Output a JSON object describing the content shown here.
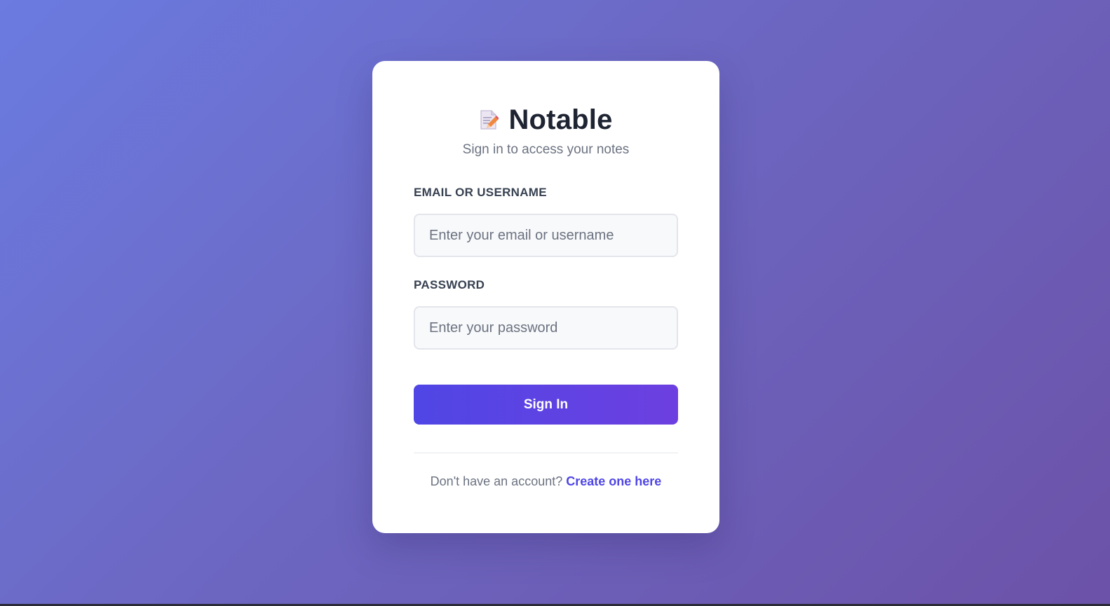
{
  "app": {
    "title": "Notable",
    "logo_icon": "memo-pencil-icon",
    "subtitle": "Sign in to access your notes"
  },
  "form": {
    "email_label": "EMAIL OR USERNAME",
    "email_placeholder": "Enter your email or username",
    "email_value": "",
    "password_label": "PASSWORD",
    "password_placeholder": "Enter your password",
    "password_value": "",
    "submit_label": "Sign In"
  },
  "footer": {
    "prompt": "Don't have an account?",
    "link_label": "Create one here"
  },
  "colors": {
    "accent": "#4f46e5",
    "accent_end": "#6d3fe0",
    "background_start": "#6b7be0",
    "background_end": "#6c52a8"
  }
}
